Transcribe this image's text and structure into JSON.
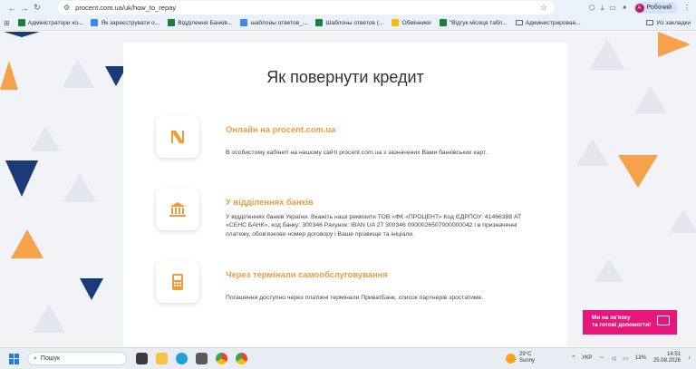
{
  "browser": {
    "url": "procent.com.ua/uk/how_to_repay",
    "profile_label": "Робочий",
    "profile_initial": "A"
  },
  "bookmarks": {
    "items": [
      {
        "label": "Адміністратори ко...",
        "color": "#188038"
      },
      {
        "label": "Як зареєструвати о...",
        "color": "#4285f4"
      },
      {
        "label": "Відділення Банків...",
        "color": "#188038"
      },
      {
        "label": "шаблоны ответов_...",
        "color": "#4285f4"
      },
      {
        "label": "Шаблоны ответов (...",
        "color": "#188038"
      },
      {
        "label": "Обмінники",
        "color": "#fbbc04"
      },
      {
        "label": "\"Відгук місяця табл...",
        "color": "#188038"
      },
      {
        "label": "Администрирован...",
        "color": "#5f6368"
      }
    ],
    "all_label": "Усі закладки"
  },
  "page": {
    "title": "Як повернути кредит",
    "methods": [
      {
        "title": "Онлайн на procent.com.ua",
        "description": "В особистому кабінеті на нашому сайті procent.com.ua з зазначених Вами банківських карт.",
        "icon": "procent-logo-icon"
      },
      {
        "title": "У відділеннях банків",
        "description": "У відділеннях банків України. Вкажіть наші реквізити ТОВ «ФК «ПРОЦЕНТ» Код ЄДРПОУ: 41466388 АТ «СЕНС БАНК», код банку: 300346 Рахунок: IBAN UA 27 300346 0000026507000000042 і в призначенні платежу, обов'язково номер договору і Ваше прізвище та ініціали.",
        "icon": "bank-building-icon"
      },
      {
        "title": "Через термінали самообслуговування",
        "description": "Погашення доступно через платіжні термінали ПриватБанк, список партнерів зростатиме.",
        "icon": "terminal-icon"
      }
    ]
  },
  "chat_widget": {
    "line1": "Ми на зв'язку",
    "line2": "та готові допомогти!",
    "icon": "chat-icon"
  },
  "taskbar": {
    "search_placeholder": "Пошук",
    "weather_temp": "29°C",
    "weather_desc": "Sunny",
    "language": "УКР",
    "battery": "13%",
    "time": "14:51",
    "date": "25.08.2026"
  },
  "colors": {
    "accent_orange": "#f39a3a",
    "navy": "#1b3a7a",
    "chat_pink": "#e6167a"
  }
}
